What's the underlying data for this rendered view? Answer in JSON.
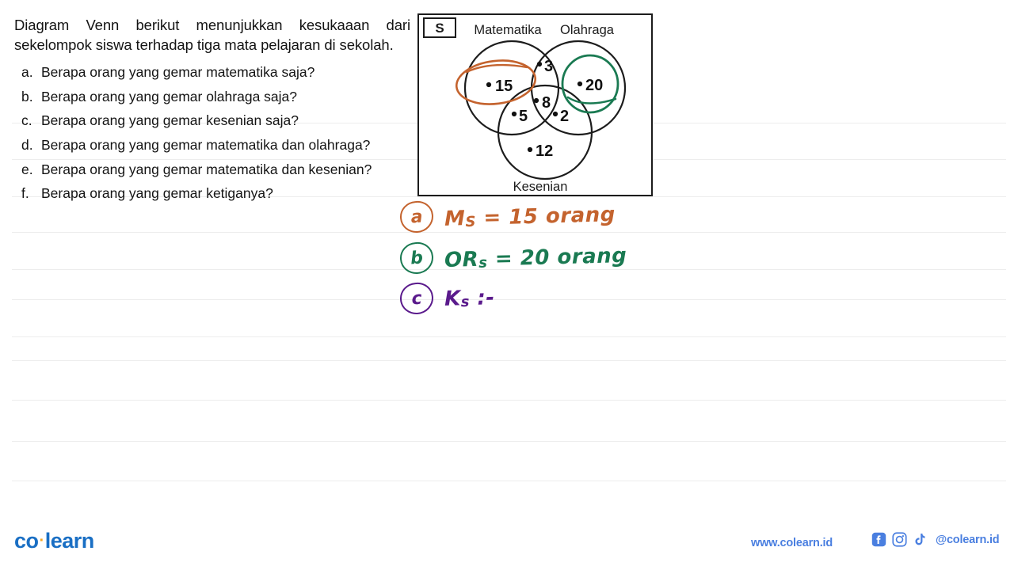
{
  "worksheet": {
    "intro": "Diagram Venn berikut menunjukkan kesukaaan dari sekelompok siswa terhadap tiga mata pelajaran di sekolah.",
    "questions": [
      {
        "letter": "a.",
        "text": "Berapa orang yang gemar matematika saja?"
      },
      {
        "letter": "b.",
        "text": "Berapa orang yang gemar olahraga saja?"
      },
      {
        "letter": "c.",
        "text": "Berapa orang yang gemar kesenian saja?"
      },
      {
        "letter": "d.",
        "text": "Berapa orang yang gemar matematika dan olahraga?"
      },
      {
        "letter": "e.",
        "text": "Berapa orang yang gemar matematika dan kesenian?"
      },
      {
        "letter": "f.",
        "text": "Berapa orang yang gemar ketiganya?"
      }
    ]
  },
  "venn": {
    "universe_label": "S",
    "set_labels": {
      "left": "Matematika",
      "right": "Olahraga",
      "bottom": "Kesenian"
    },
    "regions": [
      {
        "id": "matematika-only",
        "value": "15"
      },
      {
        "id": "matematika-olahraga",
        "value": "3"
      },
      {
        "id": "olahraga-only",
        "value": "20"
      },
      {
        "id": "matematika-kesenian",
        "value": "5"
      },
      {
        "id": "all-three",
        "value": "8"
      },
      {
        "id": "olahraga-kesenian",
        "value": "2"
      },
      {
        "id": "kesenian-only",
        "value": "12"
      }
    ],
    "annotations": [
      {
        "id": "circle-15",
        "color": "#c4632e"
      },
      {
        "id": "circle-20",
        "color": "#1a7a52"
      }
    ]
  },
  "handwriting": {
    "colors": {
      "orange": "#c4632e",
      "green": "#1a7a52",
      "purple": "#5a1a8c"
    },
    "answers": [
      {
        "bullet": "a",
        "prefix": "M",
        "sub": "S",
        "body": "= 15 orang",
        "color_key": "orange"
      },
      {
        "bullet": "b",
        "prefix": "OR",
        "sub": "s",
        "body": "= 20 orang",
        "color_key": "green"
      },
      {
        "bullet": "c",
        "prefix": "K",
        "sub": "s",
        "body": ":-",
        "color_key": "purple"
      }
    ]
  },
  "footer": {
    "logo_first": "co",
    "logo_dot": "·",
    "logo_second": "learn",
    "url": "www.colearn.id",
    "handle": "@colearn.id",
    "social": [
      "facebook-icon",
      "instagram-icon",
      "tiktok-icon"
    ],
    "brand_color": "#4a7fe0"
  },
  "rules": {
    "line_color": "#ededed",
    "y_positions": [
      155,
      201,
      248,
      293,
      340,
      378,
      425,
      455,
      505,
      557,
      607
    ]
  }
}
